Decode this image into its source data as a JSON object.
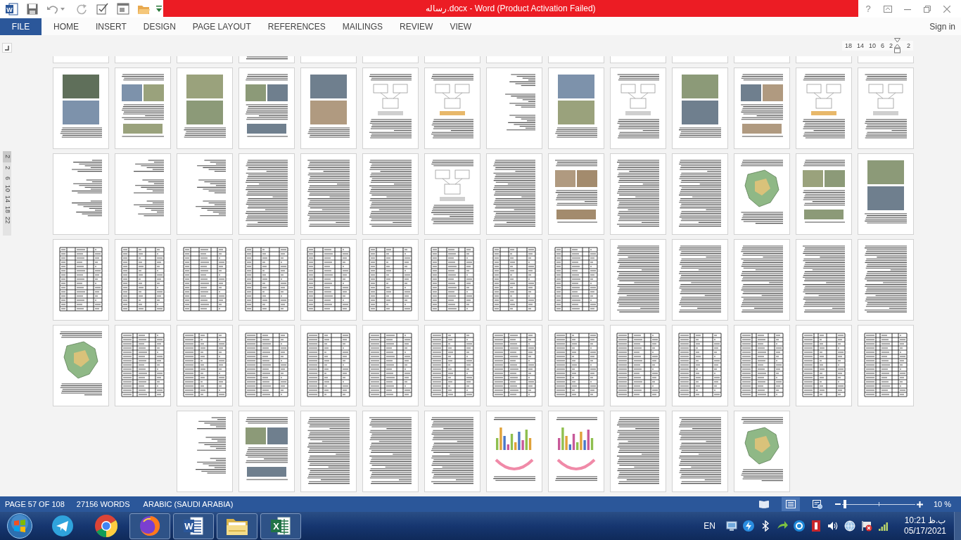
{
  "window": {
    "app_letter": "W",
    "title": "رساله.docx - Word (Product Activation Failed)",
    "help": "?"
  },
  "ribbon": {
    "file_tab": "FILE",
    "tabs": [
      {
        "label": "HOME",
        "selected": false
      },
      {
        "label": "INSERT",
        "selected": false
      },
      {
        "label": "DESIGN",
        "selected": false
      },
      {
        "label": "PAGE LAYOUT",
        "selected": false
      },
      {
        "label": "REFERENCES",
        "selected": false
      },
      {
        "label": "MAILINGS",
        "selected": false
      },
      {
        "label": "REVIEW",
        "selected": false
      },
      {
        "label": "VIEW",
        "selected": false
      }
    ],
    "sign_in": "Sign in"
  },
  "rulers": {
    "horizontal": [
      "18",
      "14",
      "10",
      "6",
      "2",
      "2"
    ],
    "vertical": [
      {
        "label": "2",
        "margin": true
      },
      {
        "label": "2",
        "margin": false
      },
      {
        "label": "6",
        "margin": false
      },
      {
        "label": "10",
        "margin": false
      },
      {
        "label": "14",
        "margin": false
      },
      {
        "label": "18",
        "margin": false
      },
      {
        "label": "22",
        "margin": false
      }
    ]
  },
  "pages": {
    "rows": [
      {
        "cut": true,
        "pages": [
          {
            "kind": "outline"
          },
          {
            "kind": "outline"
          },
          {
            "kind": "outline"
          },
          {
            "kind": "text"
          },
          {
            "kind": "outline"
          },
          {
            "kind": "outline"
          },
          {
            "kind": "outline"
          },
          {
            "kind": "outline"
          },
          {
            "kind": "outline"
          },
          {
            "kind": "outline"
          },
          {
            "kind": "outline"
          },
          {
            "kind": "outline"
          },
          {
            "kind": "outline"
          },
          {
            "kind": "outline"
          }
        ]
      },
      {
        "cut": false,
        "pages": [
          {
            "kind": "photos"
          },
          {
            "kind": "photos"
          },
          {
            "kind": "photos"
          },
          {
            "kind": "photos"
          },
          {
            "kind": "photos"
          },
          {
            "kind": "diagram"
          },
          {
            "kind": "diagram"
          },
          {
            "kind": "outline"
          },
          {
            "kind": "photos"
          },
          {
            "kind": "diagram"
          },
          {
            "kind": "photos"
          },
          {
            "kind": "photos"
          },
          {
            "kind": "diagram"
          },
          {
            "kind": "diagram"
          }
        ]
      },
      {
        "cut": false,
        "pages": [
          {
            "kind": "outline"
          },
          {
            "kind": "outline"
          },
          {
            "kind": "outline"
          },
          {
            "kind": "text"
          },
          {
            "kind": "text"
          },
          {
            "kind": "text"
          },
          {
            "kind": "diagram"
          },
          {
            "kind": "text"
          },
          {
            "kind": "photos"
          },
          {
            "kind": "text"
          },
          {
            "kind": "text"
          },
          {
            "kind": "map"
          },
          {
            "kind": "photos"
          },
          {
            "kind": "photos"
          }
        ]
      },
      {
        "cut": false,
        "pages": [
          {
            "kind": "table"
          },
          {
            "kind": "table"
          },
          {
            "kind": "table"
          },
          {
            "kind": "table"
          },
          {
            "kind": "table"
          },
          {
            "kind": "table"
          },
          {
            "kind": "table"
          },
          {
            "kind": "table"
          },
          {
            "kind": "table"
          },
          {
            "kind": "text"
          },
          {
            "kind": "text"
          },
          {
            "kind": "text"
          },
          {
            "kind": "text"
          },
          {
            "kind": "text"
          }
        ]
      },
      {
        "cut": false,
        "pages": [
          {
            "kind": "map"
          },
          {
            "kind": "table"
          },
          {
            "kind": "table"
          },
          {
            "kind": "table"
          },
          {
            "kind": "table"
          },
          {
            "kind": "table"
          },
          {
            "kind": "table"
          },
          {
            "kind": "table"
          },
          {
            "kind": "table"
          },
          {
            "kind": "table"
          },
          {
            "kind": "table"
          },
          {
            "kind": "table"
          },
          {
            "kind": "table"
          },
          {
            "kind": "table"
          }
        ]
      },
      {
        "cut": false,
        "pages": [
          {
            "kind": "outline"
          },
          {
            "kind": "photos"
          },
          {
            "kind": "text"
          },
          {
            "kind": "text"
          },
          {
            "kind": "text"
          },
          {
            "kind": "chart"
          },
          {
            "kind": "chart"
          },
          {
            "kind": "text"
          },
          {
            "kind": "text"
          },
          {
            "kind": "map"
          }
        ]
      }
    ]
  },
  "status_bar": {
    "page": "PAGE 57 OF 108",
    "words": "27156 WORDS",
    "language": "ARABIC (SAUDI ARABIA)",
    "views": [
      {
        "kind": "read",
        "selected": false
      },
      {
        "kind": "print",
        "selected": true
      },
      {
        "kind": "web",
        "selected": false
      }
    ],
    "zoom": {
      "level": 0.02,
      "reading": "10 %"
    }
  },
  "taskbar": {
    "apps": [
      {
        "kind": "start"
      },
      {
        "kind": "telegram",
        "running": false
      },
      {
        "kind": "chrome",
        "running": false
      },
      {
        "kind": "firefox",
        "running": true
      },
      {
        "kind": "word",
        "letter": "W",
        "running": true
      },
      {
        "kind": "explorer",
        "running": true
      },
      {
        "kind": "excel",
        "letter": "X",
        "running": true
      }
    ],
    "language": "EN",
    "clock": {
      "time": "10:21 ب.ظ",
      "date": "05/17/2021"
    }
  }
}
